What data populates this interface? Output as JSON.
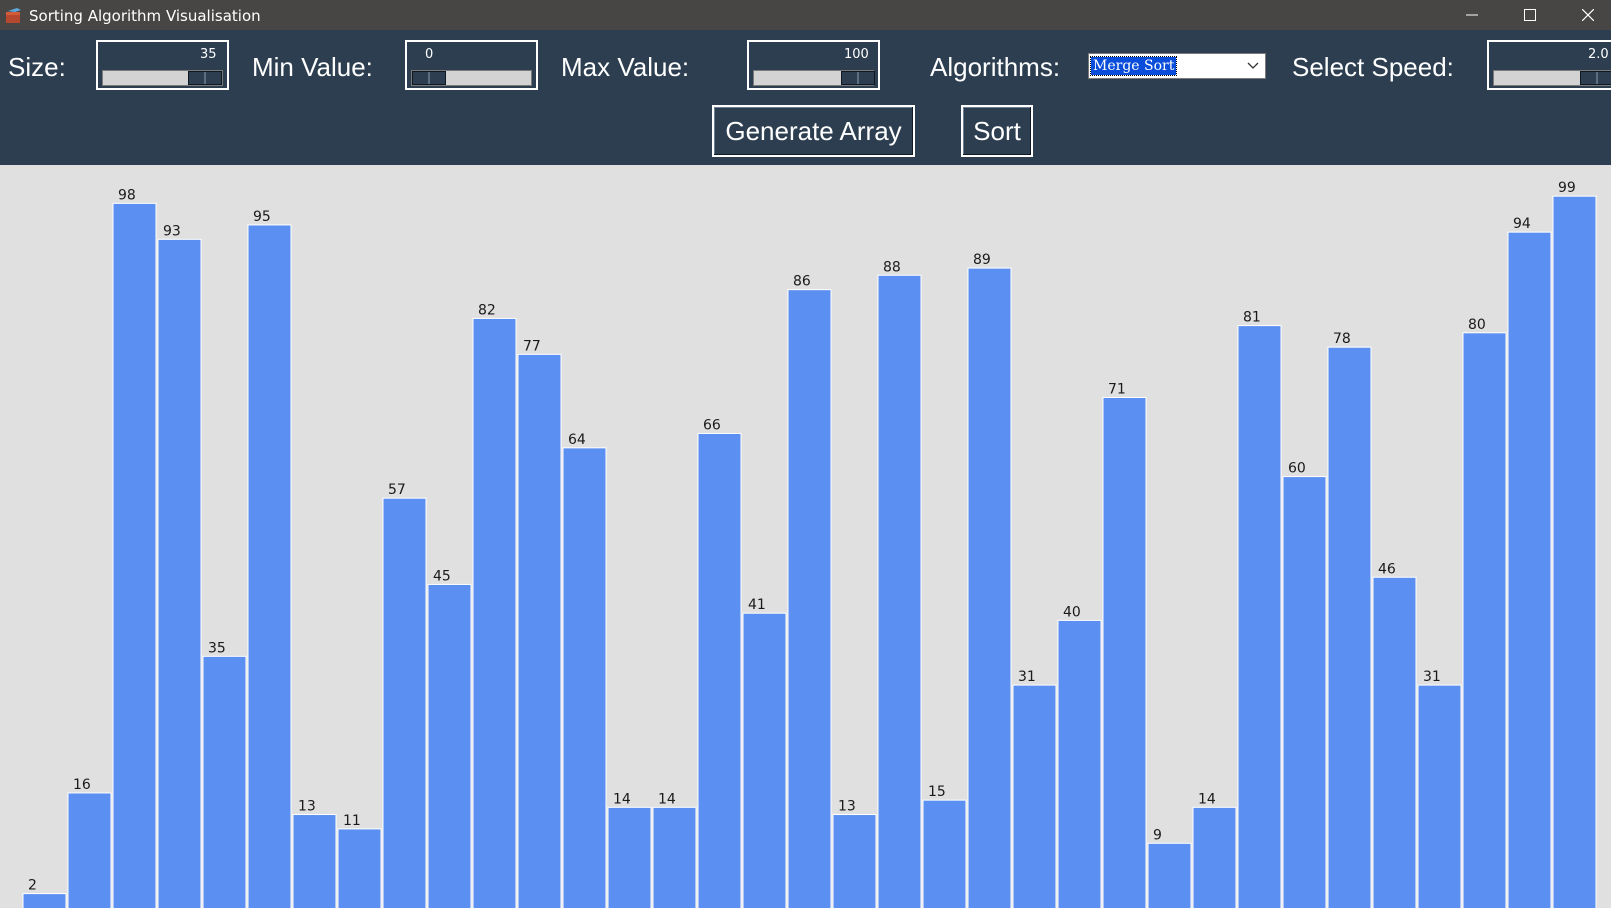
{
  "window": {
    "title": "Sorting Algorithm Visualisation",
    "controls": [
      "minimize-icon",
      "maximize-icon",
      "close-icon"
    ]
  },
  "controls": {
    "size": {
      "label": "Size:",
      "value": "35",
      "level": 0.85
    },
    "min_value": {
      "label": "Min Value:",
      "value": "0",
      "level": 0.0
    },
    "max_value": {
      "label": "Max Value:",
      "value": "100",
      "level": 0.88
    },
    "algorithms": {
      "label": "Algorithms:",
      "selected": "Merge Sort"
    },
    "speed": {
      "label": "Select Speed:",
      "value": "2.0",
      "level": 0.9
    },
    "generate_button": "Generate Array",
    "sort_button": "Sort"
  },
  "colors": {
    "panel_bg": "#2c3e50",
    "canvas_bg": "#e0e0e0",
    "bar": "#5b8ff2",
    "bar_border": "#ffffff",
    "text": "#ffffff"
  },
  "chart_data": {
    "type": "bar",
    "max_value": 100,
    "values": [
      2,
      16,
      98,
      93,
      35,
      95,
      13,
      11,
      57,
      45,
      82,
      77,
      64,
      14,
      14,
      66,
      41,
      86,
      13,
      88,
      15,
      89,
      31,
      40,
      71,
      9,
      14,
      81,
      60,
      78,
      46,
      31,
      80,
      94,
      99
    ]
  }
}
